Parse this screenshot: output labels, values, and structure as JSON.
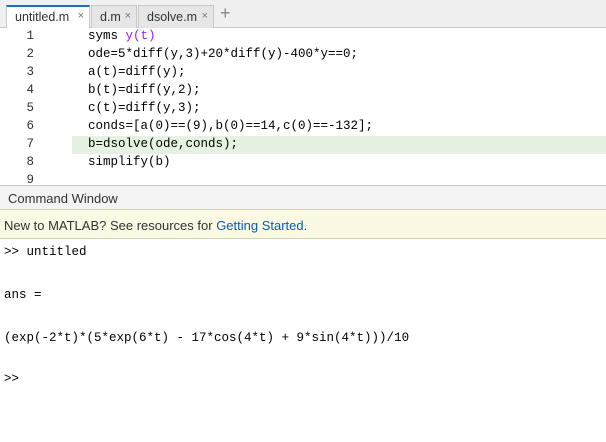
{
  "tabs": [
    {
      "label": "untitled.m",
      "active": true
    },
    {
      "label": "d.m",
      "active": false
    },
    {
      "label": "dsolve.m",
      "active": false
    }
  ],
  "tab_close_glyph": "×",
  "add_tab_glyph": "+",
  "editor": {
    "lines": [
      {
        "num": "1",
        "plain": "syms ",
        "var": "y(t)",
        "rest": ""
      },
      {
        "num": "2",
        "plain": "ode=5*diff(y,3)+20*diff(y)-400*y==0;",
        "var": "",
        "rest": ""
      },
      {
        "num": "3",
        "plain": "a(t)=diff(y);",
        "var": "",
        "rest": ""
      },
      {
        "num": "4",
        "plain": "b(t)=diff(y,2);",
        "var": "",
        "rest": ""
      },
      {
        "num": "5",
        "plain": "c(t)=diff(y,3);",
        "var": "",
        "rest": ""
      },
      {
        "num": "6",
        "plain": "conds=[a(0)==(9),b(0)==14,c(0)==-132];",
        "var": "",
        "rest": ""
      },
      {
        "num": "7",
        "plain": "b=dsolve(ode,conds);",
        "var": "",
        "rest": "",
        "highlight": true
      },
      {
        "num": "8",
        "plain": "simplify(b)",
        "var": "",
        "rest": ""
      },
      {
        "num": "9",
        "plain": "",
        "var": "",
        "rest": ""
      }
    ]
  },
  "command_window": {
    "title": "Command Window",
    "banner": {
      "prefix": "New to MATLAB? See resources for ",
      "link": "Getting Started",
      "suffix": "."
    },
    "output": [
      ">> untitled",
      "ans =",
      "(exp(-2*t)*(5*exp(6*t) - 17*cos(4*t) + 9*sin(4*t)))/10",
      ">>"
    ]
  },
  "colors": {
    "accent": "#1e6fc3",
    "highlight_line": "#e5f2e2",
    "symbolic_var": "#a020f0",
    "link": "#0b5cad",
    "banner_bg": "#fbf9e4"
  }
}
